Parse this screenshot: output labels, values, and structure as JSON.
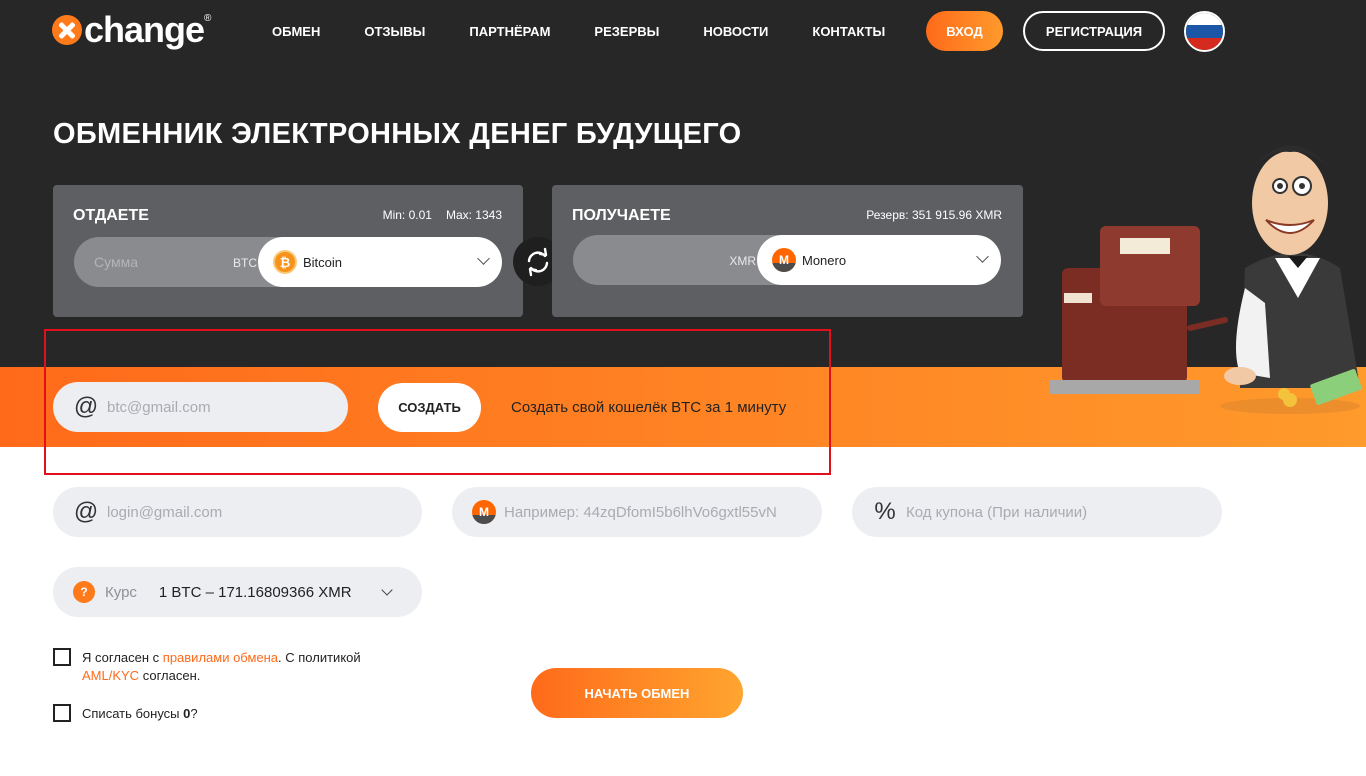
{
  "header": {
    "logo_text": "change",
    "logo_reg": "®",
    "nav": [
      "ОБМЕН",
      "ОТЗЫВЫ",
      "ПАРТНЁРАМ",
      "РЕЗЕРВЫ",
      "НОВОСТИ",
      "КОНТАКТЫ"
    ],
    "login_label": "ВХОД",
    "register_label": "РЕГИСТРАЦИЯ",
    "language_flag": "ru-flag-icon"
  },
  "hero": {
    "title": "ОБМЕННИК ЭЛЕКТРОННЫХ ДЕНЕГ БУДУЩЕГО"
  },
  "give": {
    "title": "ОТДАЕТЕ",
    "min": "Min: 0.01",
    "max": "Max: 1343",
    "amount_placeholder": "Сумма",
    "currency_code": "BTC",
    "currency_name": "Bitcoin",
    "coin_symbol": "₿"
  },
  "get": {
    "title": "ПОЛУЧАЕТЕ",
    "reserve": "Резерв: 351 915.96 XMR",
    "currency_code": "XMR",
    "currency_name": "Monero",
    "coin_symbol": "M"
  },
  "wallet": {
    "email_placeholder": "btc@gmail.com",
    "create_label": "СОЗДАТЬ",
    "text": "Создать свой кошелёк BTC за 1 минуту"
  },
  "form": {
    "email_placeholder": "login@gmail.com",
    "address_placeholder": "Например: 44zqDfomI5b6lhVo6gxtl55vN",
    "coupon_placeholder": "Код купона (При наличии)",
    "rate_label": "Курс",
    "rate_value": "1 BTC – 171.16809366 XMR",
    "rate_help": "?"
  },
  "agreement": {
    "part1": "Я согласен с ",
    "rules_link": "правилами обмена",
    "part2": ". С политикой ",
    "aml_link": "AML/KYC",
    "part3": " согласен."
  },
  "bonus": {
    "part1": "Списать бонусы ",
    "amount": "0",
    "part2": "?"
  },
  "start_label": "НАЧАТЬ ОБМЕН",
  "colors": {
    "accent": "#ff7a1a",
    "dark_bg": "#272727",
    "panel_bg": "#5e5f63",
    "highlight": "#e3101b"
  }
}
